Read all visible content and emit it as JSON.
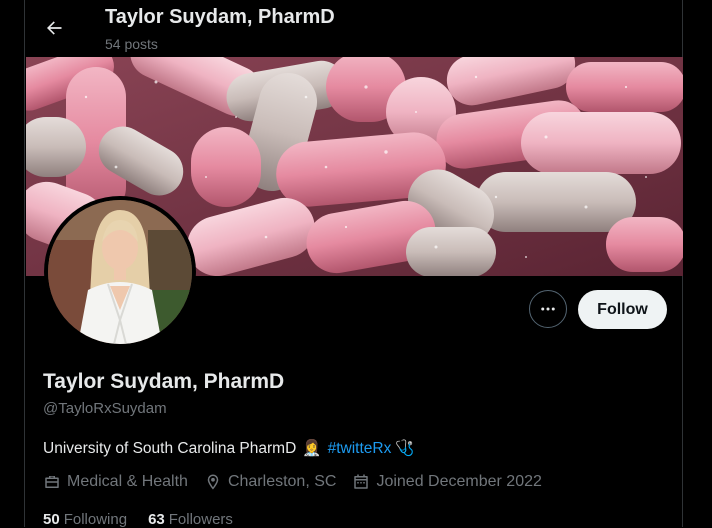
{
  "header": {
    "title": "Taylor Suydam, PharmD",
    "post_count": "54 posts"
  },
  "profile": {
    "display_name": "Taylor Suydam, PharmD",
    "handle": "@TayloRxSuydam",
    "bio_text": "University of South Carolina PharmD",
    "bio_emoji_1": "👩‍⚕️",
    "bio_hashtag": "#twitteRx",
    "bio_emoji_2": "🩺",
    "category": "Medical & Health",
    "location": "Charleston, SC",
    "joined": "Joined December 2022",
    "following_count": "50",
    "following_label": "Following",
    "followers_count": "63",
    "followers_label": "Followers"
  },
  "actions": {
    "follow_label": "Follow",
    "more_icon": "more-horizontal-icon",
    "back_icon": "arrow-left-icon"
  },
  "colors": {
    "background": "#000000",
    "text": "#e7e9ea",
    "secondary_text": "#71767b",
    "link": "#1d9bf0",
    "follow_button_bg": "#eff3f4"
  }
}
